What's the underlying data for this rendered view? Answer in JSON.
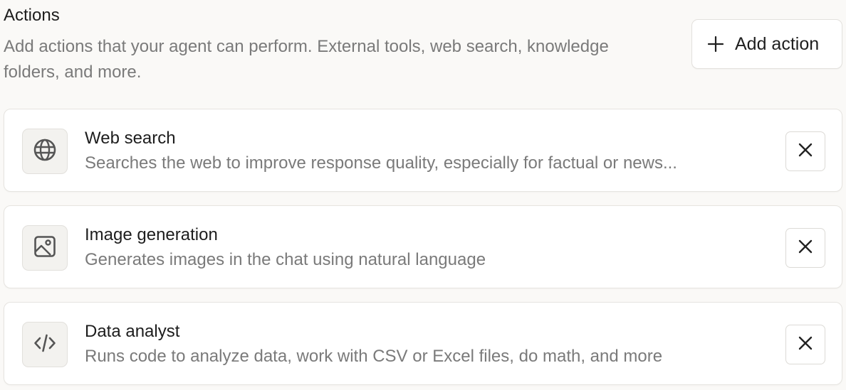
{
  "header": {
    "title": "Actions",
    "description": "Add actions that your agent can perform. External tools, web search, knowledge folders, and more.",
    "add_button_label": "Add action",
    "add_button_icon": "plus-icon"
  },
  "actions": [
    {
      "title": "Web search",
      "description": "Searches the web to improve response quality, especially for factual or news...",
      "icon": "globe-icon",
      "remove_icon": "close-icon"
    },
    {
      "title": "Image generation",
      "description": "Generates images in the chat using natural language",
      "icon": "image-icon",
      "remove_icon": "close-icon"
    },
    {
      "title": "Data analyst",
      "description": "Runs code to analyze data, work with CSV or Excel files, do math, and more",
      "icon": "code-icon",
      "remove_icon": "close-icon"
    }
  ],
  "colors": {
    "background": "#faf9f7",
    "card": "#ffffff",
    "text_primary": "#1d1d1d",
    "text_secondary": "#7a7a7a"
  }
}
